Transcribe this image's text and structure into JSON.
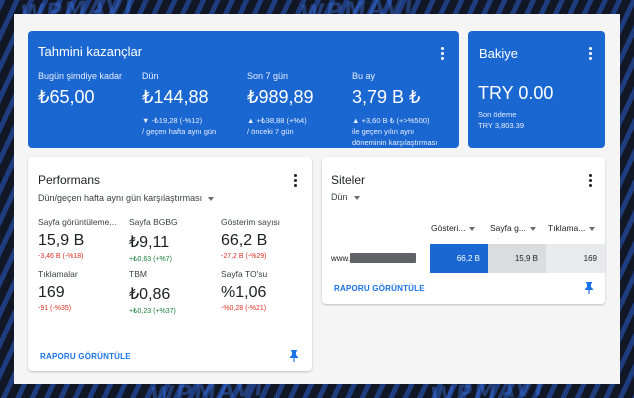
{
  "watermark": "WPMAVI",
  "earnings": {
    "title": "Tahmini kazançlar",
    "metrics": [
      {
        "label": "Bugün şimdiye kadar",
        "value": "₺65,00",
        "sub1": "",
        "sub2": "",
        "sub3": ""
      },
      {
        "label": "Dün",
        "value": "₺144,88",
        "sub1": "▼ -₺19,28 (-%12)",
        "sub2": "/ geçen hafta aynı gün",
        "sub3": ""
      },
      {
        "label": "Son 7 gün",
        "value": "₺989,89",
        "sub1": "▲ +₺38,88 (+%4)",
        "sub2": "/ önceki 7 gün",
        "sub3": ""
      },
      {
        "label": "Bu ay",
        "value": "3,79 B ₺",
        "sub1": "▲ +3,60 B ₺ (+>%500)",
        "sub2": "ile geçen yılın aynı",
        "sub3": "döneminin karşılaştırması"
      }
    ]
  },
  "balance": {
    "title": "Bakiye",
    "value": "TRY 0.00",
    "last_payment_label": "Son ödeme",
    "last_payment_value": "TRY 3,803.39"
  },
  "performance": {
    "title": "Performans",
    "dropdown": "Dün/geçen hafta aynı gün karşılaştırması",
    "stats": [
      {
        "label": "Sayfa görüntüleme...",
        "value": "15,9 B",
        "change": "-3,46 B (-%18)",
        "trend": "neg"
      },
      {
        "label": "Sayfa BGBG",
        "value": "₺9,11",
        "change": "+₺0,63 (+%7)",
        "trend": "pos"
      },
      {
        "label": "Gösterim sayısı",
        "value": "66,2 B",
        "change": "-27,2 B (-%29)",
        "trend": "neg"
      },
      {
        "label": "Tıklamalar",
        "value": "169",
        "change": "-91 (-%35)",
        "trend": "neg"
      },
      {
        "label": "TBM",
        "value": "₺0,86",
        "change": "+₺0,23 (+%37)",
        "trend": "pos"
      },
      {
        "label": "Sayfa TO'su",
        "value": "%1,06",
        "change": "-%0,28 (-%21)",
        "trend": "neg"
      }
    ],
    "report_link": "RAPORU GÖRÜNTÜLE"
  },
  "sites": {
    "title": "Siteler",
    "dropdown": "Dün",
    "columns": [
      "Gösteri...",
      "Sayfa g...",
      "Tıklama..."
    ],
    "rows": [
      {
        "site": "www.",
        "impressions": "66,2 B",
        "page_views": "15,9 B",
        "clicks": "169"
      }
    ],
    "report_link": "RAPORU GÖRÜNTÜLE"
  },
  "colors": {
    "accent": "#1a67d2",
    "link": "#1a73e8",
    "negative": "#d93025",
    "positive": "#188038"
  }
}
